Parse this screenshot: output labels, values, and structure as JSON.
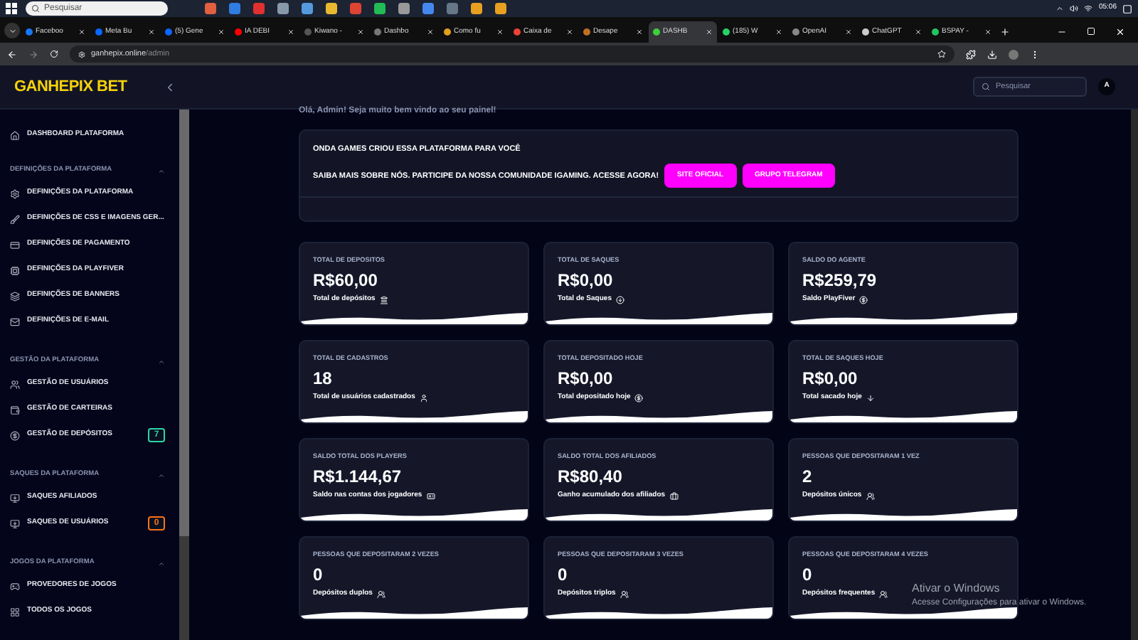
{
  "taskbar": {
    "search_placeholder": "Pesquisar",
    "time": "05:06"
  },
  "browser": {
    "tabs": [
      {
        "label": "Faceboo",
        "selected": false,
        "color": "#1877f2"
      },
      {
        "label": "Meta Bu",
        "selected": false,
        "color": "#0a66ff"
      },
      {
        "label": "(5) Gene",
        "selected": false,
        "color": "#0a66ff"
      },
      {
        "label": "IA DEBI",
        "selected": false,
        "color": "#ff0000"
      },
      {
        "label": "Kiwano -",
        "selected": false,
        "color": "#555555"
      },
      {
        "label": "Dashbo",
        "selected": false,
        "color": "#777777"
      },
      {
        "label": "Como fu",
        "selected": false,
        "color": "#e0a020"
      },
      {
        "label": "Caixa de",
        "selected": false,
        "color": "#ea4335"
      },
      {
        "label": "Desape",
        "selected": false,
        "color": "#c07020"
      },
      {
        "label": "DASHB",
        "selected": true,
        "color": "#3ecf3e"
      },
      {
        "label": "(185) W",
        "selected": false,
        "color": "#25d366"
      },
      {
        "label": "OpenAI",
        "selected": false,
        "color": "#888888"
      },
      {
        "label": "ChatGPT",
        "selected": false,
        "color": "#cccccc"
      },
      {
        "label": "BSPAY -",
        "selected": false,
        "color": "#22c55e"
      }
    ],
    "url_host": "ganhepix.online",
    "url_path": "/admin"
  },
  "header": {
    "logo": "GANHEPIX BET",
    "search_placeholder": "Pesquisar",
    "avatar": "A"
  },
  "sidebar": {
    "top_item": "DASHBOARD PLATAFORMA",
    "sections": [
      {
        "title": "DEFINIÇÕES DA PLATAFORMA",
        "expanded": true,
        "items": [
          {
            "label": "DEFINIÇÕES DA PLATAFORMA"
          },
          {
            "label": "DEFINIÇÕES DE CSS E IMAGENS GER..."
          },
          {
            "label": "DEFINIÇÕES DE PAGAMENTO"
          },
          {
            "label": "DEFINIÇÕES DA PLAYFIVER"
          },
          {
            "label": "DEFINIÇÕES DE BANNERS"
          },
          {
            "label": "DEFINIÇÕES DE E-MAIL"
          }
        ]
      },
      {
        "title": "GESTÃO DA PLATAFORMA",
        "expanded": true,
        "items": [
          {
            "label": "GESTÃO DE USUÁRIOS"
          },
          {
            "label": "GESTÃO DE CARTEIRAS"
          },
          {
            "label": "GESTÃO DE DEPÓSITOS",
            "badge": "7",
            "color": "#2dd4a7"
          }
        ]
      },
      {
        "title": "SAQUES DA PLATAFORMA",
        "expanded": true,
        "items": [
          {
            "label": "SAQUES AFILIADOS"
          },
          {
            "label": "SAQUES DE USUÁRIOS",
            "badge": "0",
            "color": "#f97316"
          }
        ]
      },
      {
        "title": "JOGOS DA PLATAFORMA",
        "expanded": true,
        "items": [
          {
            "label": "PROVEDORES DE JOGOS"
          },
          {
            "label": "TODOS OS JOGOS"
          }
        ]
      }
    ]
  },
  "welcome": "Olá, Admin! Seja muito bem vindo ao seu painel!",
  "banner": {
    "title": "ONDA GAMES CRIOU ESSA PLATAFORMA PARA VOCÊ",
    "text": "SAIBA MAIS SOBRE NÓS. PARTICIPE DA NOSSA COMUNIDADE IGAMING. ACESSE AGORA!",
    "buttons": [
      "SITE OFICIAL",
      "GRUPO TELEGRAM"
    ]
  },
  "cards": [
    {
      "title": "TOTAL DE DEPOSITOS",
      "value": "R$60,00",
      "caption": "Total de depósitos"
    },
    {
      "title": "TOTAL DE SAQUES",
      "value": "R$0,00",
      "caption": "Total de Saques"
    },
    {
      "title": "SALDO DO AGENTE",
      "value": "R$259,79",
      "caption": "Saldo PlayFiver"
    },
    {
      "title": "TOTAL DE CADASTROS",
      "value": "18",
      "caption": "Total de usuários cadastrados"
    },
    {
      "title": "TOTAL DEPOSITADO HOJE",
      "value": "R$0,00",
      "caption": "Total depositado hoje"
    },
    {
      "title": "TOTAL DE SAQUES HOJE",
      "value": "R$0,00",
      "caption": "Total sacado hoje"
    },
    {
      "title": "SALDO TOTAL DOS PLAYERS",
      "value": "R$1.144,67",
      "caption": "Saldo nas contas dos jogadores"
    },
    {
      "title": "SALDO TOTAL DOS AFILIADOS",
      "value": "R$80,40",
      "caption": "Ganho acumulado dos afiliados"
    },
    {
      "title": "PESSOAS QUE DEPOSITARAM 1 VEZ",
      "value": "2",
      "caption": "Depósitos únicos"
    },
    {
      "title": "PESSOAS QUE DEPOSITARAM 2 VEZES",
      "value": "0",
      "caption": "Depósitos duplos"
    },
    {
      "title": "PESSOAS QUE DEPOSITARAM 3 VEZES",
      "value": "0",
      "caption": "Depósitos triplos"
    },
    {
      "title": "PESSOAS QUE DEPOSITARAM 4 VEZES",
      "value": "0",
      "caption": "Depósitos frequentes"
    }
  ],
  "os_notice": {
    "title": "Ativar o Windows",
    "text": "Acesse Configurações para ativar o Windows."
  }
}
